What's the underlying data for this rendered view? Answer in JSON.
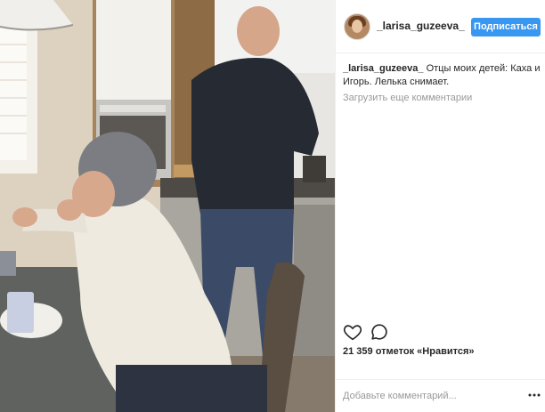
{
  "post": {
    "username": "_larisa_guzeeva_",
    "follow_label": "Подписаться",
    "caption_user": "_larisa_guzeeva_",
    "caption_text": "Отцы моих детей: Каха и Игорь. Лелька снимает.",
    "load_more": "Загрузить еще комментарии",
    "likes": "21 359 отметок «Нравится»",
    "comment_placeholder": "Добавьте комментарий..."
  },
  "icons": [
    "heart-icon",
    "comment-icon",
    "more-options-icon"
  ],
  "colors": {
    "accent": "#3897f0",
    "muted": "#999999",
    "text": "#262626",
    "border": "#efefef"
  }
}
